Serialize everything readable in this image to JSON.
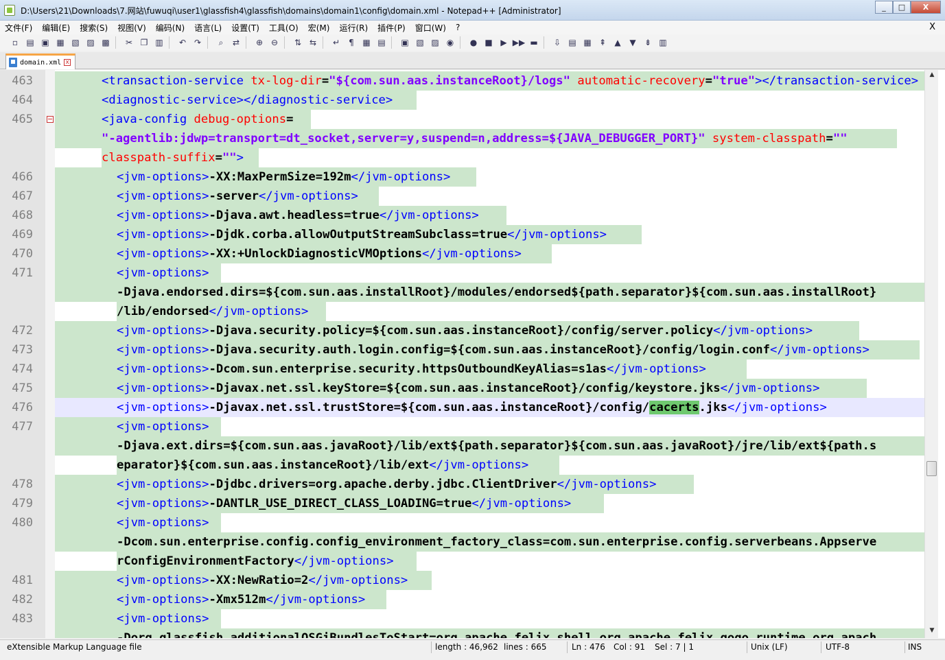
{
  "window": {
    "title": "D:\\Users\\21\\Downloads\\7.网站\\fuwuqi\\user1\\glassfish4\\glassfish\\domains\\domain1\\config\\domain.xml - Notepad++ [Administrator]",
    "minimize": "_",
    "maximize": "□",
    "close": "X"
  },
  "menu": {
    "items": [
      "文件(F)",
      "编辑(E)",
      "搜索(S)",
      "视图(V)",
      "编码(N)",
      "语言(L)",
      "设置(T)",
      "工具(O)",
      "宏(M)",
      "运行(R)",
      "插件(P)",
      "窗口(W)",
      "?"
    ],
    "close": "X"
  },
  "toolbar": {
    "icons": [
      "new-file-icon",
      "open-file-icon",
      "save-icon",
      "save-all-icon",
      "close-icon",
      "close-all-icon",
      "print-icon",
      "cut-icon",
      "copy-icon",
      "paste-icon",
      "undo-icon",
      "redo-icon",
      "find-icon",
      "replace-icon",
      "zoom-in-icon",
      "zoom-out-icon",
      "sync-vertical-icon",
      "sync-horizontal-icon",
      "word-wrap-icon",
      "show-all-chars-icon",
      "indent-guide-icon",
      "udl-icon",
      "doc-map-icon",
      "function-list-icon",
      "folder-workspace-icon",
      "monitoring-icon",
      "record-macro-icon",
      "stop-record-icon",
      "play-macro-icon",
      "run-macro-multiple-icon",
      "save-macro-icon",
      "compare-icon",
      "compare-nav-1-icon",
      "compare-nav-2-icon",
      "first-icon",
      "prev-icon",
      "next-icon",
      "last-icon",
      "diff-bar-icon"
    ],
    "glyphs": [
      "▫",
      "▤",
      "▣",
      "▦",
      "▧",
      "▨",
      "▩",
      "✂",
      "❐",
      "▥",
      "↶",
      "↷",
      "⌕",
      "⇄",
      "⊕",
      "⊖",
      "⇅",
      "⇆",
      "↵",
      "¶",
      "▦",
      "▤",
      "▣",
      "▧",
      "▨",
      "◉",
      "●",
      "■",
      "▶",
      "▶▶",
      "▬",
      "⇩",
      "▤",
      "▦",
      "⇞",
      "▲",
      "▼",
      "⇟",
      "▥"
    ]
  },
  "tab": {
    "label": "domain.xml",
    "close": "x"
  },
  "lines": [
    {
      "num": "463",
      "parts": [
        [
          "t",
          "<transaction-service"
        ],
        [
          "x",
          " "
        ],
        [
          "a",
          "tx-log-dir"
        ],
        [
          "x",
          "="
        ],
        [
          "v",
          "\"${com.sun.aas.instanceRoot}/logs\""
        ],
        [
          "x",
          " "
        ],
        [
          "a",
          "automatic-recovery"
        ],
        [
          "x",
          "="
        ],
        [
          "v",
          "\"true\""
        ],
        [
          "t",
          "></transaction-service>"
        ]
      ]
    },
    {
      "num": "464",
      "parts": [
        [
          "t",
          "<diagnostic-service></diagnostic-service>"
        ]
      ]
    },
    {
      "num": "465",
      "parts": [
        [
          "t",
          "<java-config"
        ],
        [
          "x",
          " "
        ],
        [
          "a",
          "debug-options"
        ],
        [
          "x",
          "="
        ]
      ],
      "fold": true
    },
    {
      "num": "",
      "parts": [
        [
          "v",
          "\"-agentlib:jdwp=transport=dt_socket,server=y,suspend=n,address=${JAVA_DEBUGGER_PORT}\""
        ],
        [
          "x",
          " "
        ],
        [
          "a",
          "system-classpath"
        ],
        [
          "x",
          "="
        ],
        [
          "v",
          "\"\""
        ]
      ],
      "wrap": true
    },
    {
      "num": "",
      "parts": [
        [
          "a",
          "classpath-suffix"
        ],
        [
          "x",
          "="
        ],
        [
          "v",
          "\"\""
        ],
        [
          "t",
          ">"
        ]
      ],
      "wrap": true,
      "nobg": true
    },
    {
      "num": "466",
      "parts": [
        [
          "t",
          "<jvm-options>"
        ],
        [
          "x",
          "-XX:MaxPermSize=192m"
        ],
        [
          "t",
          "</jvm-options>"
        ]
      ],
      "indent": 1
    },
    {
      "num": "467",
      "parts": [
        [
          "t",
          "<jvm-options>"
        ],
        [
          "x",
          "-server"
        ],
        [
          "t",
          "</jvm-options>"
        ]
      ],
      "indent": 1
    },
    {
      "num": "468",
      "parts": [
        [
          "t",
          "<jvm-options>"
        ],
        [
          "x",
          "-Djava.awt.headless=true"
        ],
        [
          "t",
          "</jvm-options>"
        ]
      ],
      "indent": 1
    },
    {
      "num": "469",
      "parts": [
        [
          "t",
          "<jvm-options>"
        ],
        [
          "x",
          "-Djdk.corba.allowOutputStreamSubclass=true"
        ],
        [
          "t",
          "</jvm-options>"
        ]
      ],
      "indent": 1
    },
    {
      "num": "470",
      "parts": [
        [
          "t",
          "<jvm-options>"
        ],
        [
          "x",
          "-XX:+UnlockDiagnosticVMOptions"
        ],
        [
          "t",
          "</jvm-options>"
        ]
      ],
      "indent": 1
    },
    {
      "num": "471",
      "parts": [
        [
          "t",
          "<jvm-options>"
        ]
      ],
      "indent": 1
    },
    {
      "num": "",
      "parts": [
        [
          "x",
          "-Djava.endorsed.dirs=${com.sun.aas.installRoot}/modules/endorsed${path.separator}${com.sun.aas.installRoot}"
        ]
      ],
      "indent": 1,
      "wrap": true
    },
    {
      "num": "",
      "parts": [
        [
          "x",
          "/lib/endorsed"
        ],
        [
          "t",
          "</jvm-options>"
        ]
      ],
      "indent": 1,
      "wrap": true,
      "nobg": true
    },
    {
      "num": "472",
      "parts": [
        [
          "t",
          "<jvm-options>"
        ],
        [
          "x",
          "-Djava.security.policy=${com.sun.aas.instanceRoot}/config/server.policy"
        ],
        [
          "t",
          "</jvm-options>"
        ]
      ],
      "indent": 1
    },
    {
      "num": "473",
      "parts": [
        [
          "t",
          "<jvm-options>"
        ],
        [
          "x",
          "-Djava.security.auth.login.config=${com.sun.aas.instanceRoot}/config/login.conf"
        ],
        [
          "t",
          "</jvm-options>"
        ]
      ],
      "indent": 1
    },
    {
      "num": "474",
      "parts": [
        [
          "t",
          "<jvm-options>"
        ],
        [
          "x",
          "-Dcom.sun.enterprise.security.httpsOutboundKeyAlias=s1as"
        ],
        [
          "t",
          "</jvm-options>"
        ]
      ],
      "indent": 1
    },
    {
      "num": "475",
      "parts": [
        [
          "t",
          "<jvm-options>"
        ],
        [
          "x",
          "-Djavax.net.ssl.keyStore=${com.sun.aas.instanceRoot}/config/keystore.jks"
        ],
        [
          "t",
          "</jvm-options>"
        ]
      ],
      "indent": 1
    },
    {
      "num": "476",
      "parts": [
        [
          "t",
          "<jvm-options>"
        ],
        [
          "x",
          "-Djavax.net.ssl.trustStore=${com.sun.aas.instanceRoot}/config/"
        ],
        [
          "s",
          "cacerts"
        ],
        [
          "x",
          ".jks"
        ],
        [
          "t",
          "</jvm-options>"
        ]
      ],
      "indent": 1,
      "current": true
    },
    {
      "num": "477",
      "parts": [
        [
          "t",
          "<jvm-options>"
        ]
      ],
      "indent": 1
    },
    {
      "num": "",
      "parts": [
        [
          "x",
          "-Djava.ext.dirs=${com.sun.aas.javaRoot}/lib/ext${path.separator}${com.sun.aas.javaRoot}/jre/lib/ext${path.s"
        ]
      ],
      "indent": 1,
      "wrap": true
    },
    {
      "num": "",
      "parts": [
        [
          "x",
          "eparator}${com.sun.aas.instanceRoot}/lib/ext"
        ],
        [
          "t",
          "</jvm-options>"
        ]
      ],
      "indent": 1,
      "wrap": true,
      "nobg": true
    },
    {
      "num": "478",
      "parts": [
        [
          "t",
          "<jvm-options>"
        ],
        [
          "x",
          "-Djdbc.drivers=org.apache.derby.jdbc.ClientDriver"
        ],
        [
          "t",
          "</jvm-options>"
        ]
      ],
      "indent": 1
    },
    {
      "num": "479",
      "parts": [
        [
          "t",
          "<jvm-options>"
        ],
        [
          "x",
          "-DANTLR_USE_DIRECT_CLASS_LOADING=true"
        ],
        [
          "t",
          "</jvm-options>"
        ]
      ],
      "indent": 1
    },
    {
      "num": "480",
      "parts": [
        [
          "t",
          "<jvm-options>"
        ]
      ],
      "indent": 1
    },
    {
      "num": "",
      "parts": [
        [
          "x",
          "-Dcom.sun.enterprise.config.config_environment_factory_class=com.sun.enterprise.config.serverbeans.Appserve"
        ]
      ],
      "indent": 1,
      "wrap": true
    },
    {
      "num": "",
      "parts": [
        [
          "x",
          "rConfigEnvironmentFactory"
        ],
        [
          "t",
          "</jvm-options>"
        ]
      ],
      "indent": 1,
      "wrap": true,
      "nobg": true
    },
    {
      "num": "481",
      "parts": [
        [
          "t",
          "<jvm-options>"
        ],
        [
          "x",
          "-XX:NewRatio=2"
        ],
        [
          "t",
          "</jvm-options>"
        ]
      ],
      "indent": 1
    },
    {
      "num": "482",
      "parts": [
        [
          "t",
          "<jvm-options>"
        ],
        [
          "x",
          "-Xmx512m"
        ],
        [
          "t",
          "</jvm-options>"
        ]
      ],
      "indent": 1
    },
    {
      "num": "483",
      "parts": [
        [
          "t",
          "<jvm-options>"
        ]
      ],
      "indent": 1
    },
    {
      "num": "",
      "parts": [
        [
          "x",
          "-Dorg.glassfish.additionalOSGiBundlesToStart=org.apache.felix.shell,org.apache.felix.gogo.runtime,org.apach"
        ]
      ],
      "indent": 1,
      "wrap": true
    }
  ],
  "status": {
    "language": "eXtensible Markup Language file",
    "length": "length : 46,962",
    "lines": "lines : 665",
    "ln": "Ln : 476",
    "col": "Col : 91",
    "sel": "Sel : 7 | 1",
    "eol": "Unix (LF)",
    "encoding": "UTF-8",
    "mode": "INS"
  },
  "colors": {
    "tag": "#0000ff",
    "attribute": "#ff0000",
    "value": "#8000ff",
    "line_highlight_bg": "#cce6cc",
    "current_line_bg": "#e8e8ff",
    "selection": "#6fc96f",
    "tab_accent": "#f7a545"
  }
}
